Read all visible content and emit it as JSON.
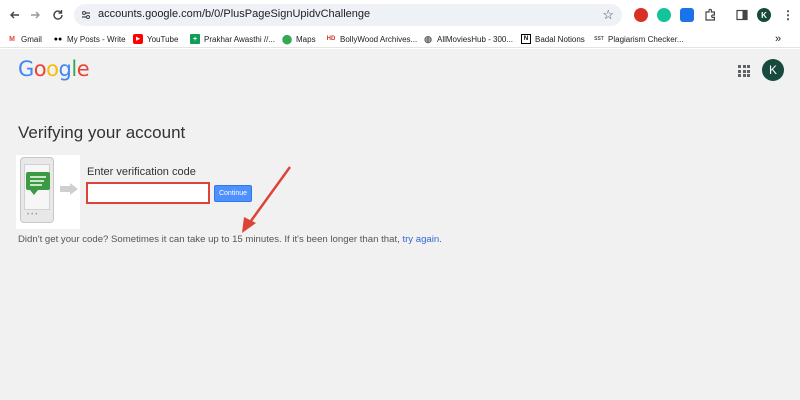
{
  "browser": {
    "url": "accounts.google.com/b/0/PlusPageSignUpidvChallenge",
    "profile_initial": "K"
  },
  "bookmarks": [
    {
      "label": "Gmail",
      "icon": "gmail-icon"
    },
    {
      "label": "My Posts - Write",
      "icon": "medium-icon"
    },
    {
      "label": "YouTube",
      "icon": "youtube-icon"
    },
    {
      "label": "Prakhar Awasthi //...",
      "icon": "sheets-icon"
    },
    {
      "label": "Maps",
      "icon": "maps-icon"
    },
    {
      "label": "BollyWood Archives...",
      "icon": "hd-icon"
    },
    {
      "label": "AllMoviesHub - 300...",
      "icon": "globe-icon"
    },
    {
      "label": "Badal Notions",
      "icon": "notion-icon"
    },
    {
      "label": "Plagiarism Checker...",
      "icon": "sst-icon"
    }
  ],
  "bookmarks_overflow": "»",
  "google": {
    "logo_letters": [
      "G",
      "o",
      "o",
      "g",
      "l",
      "e"
    ],
    "logo_colors": [
      "#4285f4",
      "#ea4335",
      "#fbbc05",
      "#4285f4",
      "#34a853",
      "#ea4335"
    ],
    "account_initial": "K"
  },
  "page": {
    "title": "Verifying your account",
    "code_label": "Enter verification code",
    "code_value": "",
    "continue_label": "Continue",
    "help_text": "Didn't get your code? Sometimes it can take up to 15 minutes. If it's been longer than that, ",
    "help_link": "try again",
    "help_end": "."
  },
  "colors": {
    "page_bg": "#f1f1f1",
    "button_blue": "#4d90fe",
    "highlight_red": "#dc4437",
    "link_blue": "#3367d6"
  }
}
